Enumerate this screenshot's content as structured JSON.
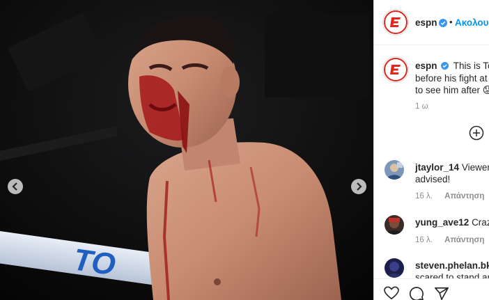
{
  "post": {
    "username": "espn",
    "follow_label": "Ακολουθ",
    "dot": "•",
    "caption_lines": [
      "This is Ton",
      "before his fight at",
      "to see him after 😟"
    ],
    "time": "1 ω",
    "media_alt_icon": "photo-of-bloodied-fighter"
  },
  "comments": [
    {
      "user": "jtaylor_14",
      "text": "Viewer",
      "text2": "advised!",
      "age": "16 λ.",
      "reply": "Απάντηση"
    },
    {
      "user": "yung_ave12",
      "text": "Crazy",
      "text2": "",
      "age": "16 λ.",
      "reply": "Απάντηση"
    },
    {
      "user": "steven.phelan.bkr",
      "text": "",
      "text2": "scared to stand ar",
      "age": "",
      "reply": ""
    }
  ],
  "icons": {
    "prev": "chevron-left-icon",
    "next": "chevron-right-icon",
    "add": "plus-circle-icon",
    "like": "heart-icon",
    "comment": "comment-icon",
    "share": "paper-plane-icon",
    "verified": "verified-badge-icon"
  },
  "colors": {
    "espn_red": "#e1261c",
    "link_blue": "#0095f6",
    "verified_blue": "#3897f0"
  }
}
